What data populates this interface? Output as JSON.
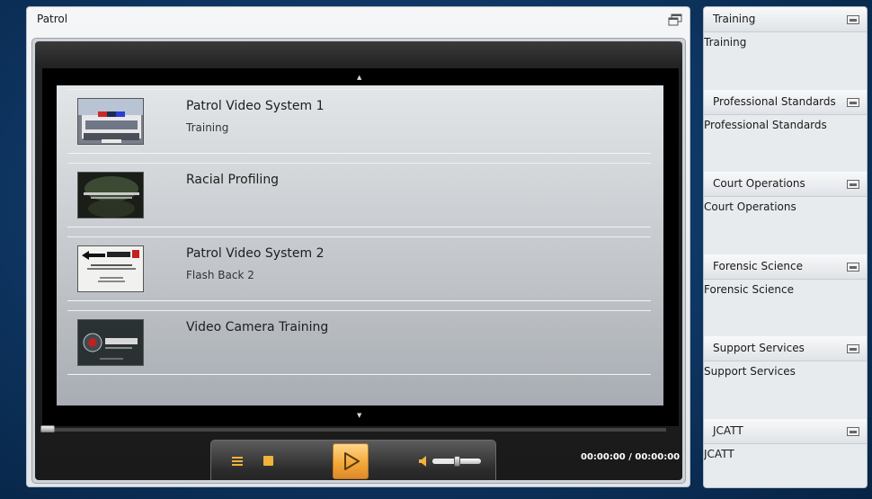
{
  "main_panel": {
    "title": "Patrol"
  },
  "playlist": {
    "items": [
      {
        "title": "Patrol Video System 1",
        "subtitle": "Training",
        "thumbnail": "police-car-thumbnail"
      },
      {
        "title": "Racial Profiling",
        "subtitle": "",
        "thumbnail": "racial-profiling-thumbnail"
      },
      {
        "title": "Patrol Video System 2",
        "subtitle": "Flash Back 2",
        "thumbnail": "flashback2-thumbnail"
      },
      {
        "title": "Video Camera Training",
        "subtitle": "",
        "thumbnail": "jcatt-thumbnail"
      }
    ]
  },
  "player": {
    "time": "00:00:00 / 00:00:00",
    "seek_progress": 0,
    "volume_level": 0.5,
    "accent_color": "#f2b33a"
  },
  "sidebar": {
    "categories": [
      {
        "title": "Training",
        "link": "Training"
      },
      {
        "title": "Professional Standards",
        "link": "Professional Standards"
      },
      {
        "title": "Court Operations",
        "link": "Court Operations"
      },
      {
        "title": "Forensic Science",
        "link": "Forensic Science"
      },
      {
        "title": "Support Services",
        "link": "Support Services"
      },
      {
        "title": "JCATT",
        "link": "JCATT"
      }
    ]
  }
}
